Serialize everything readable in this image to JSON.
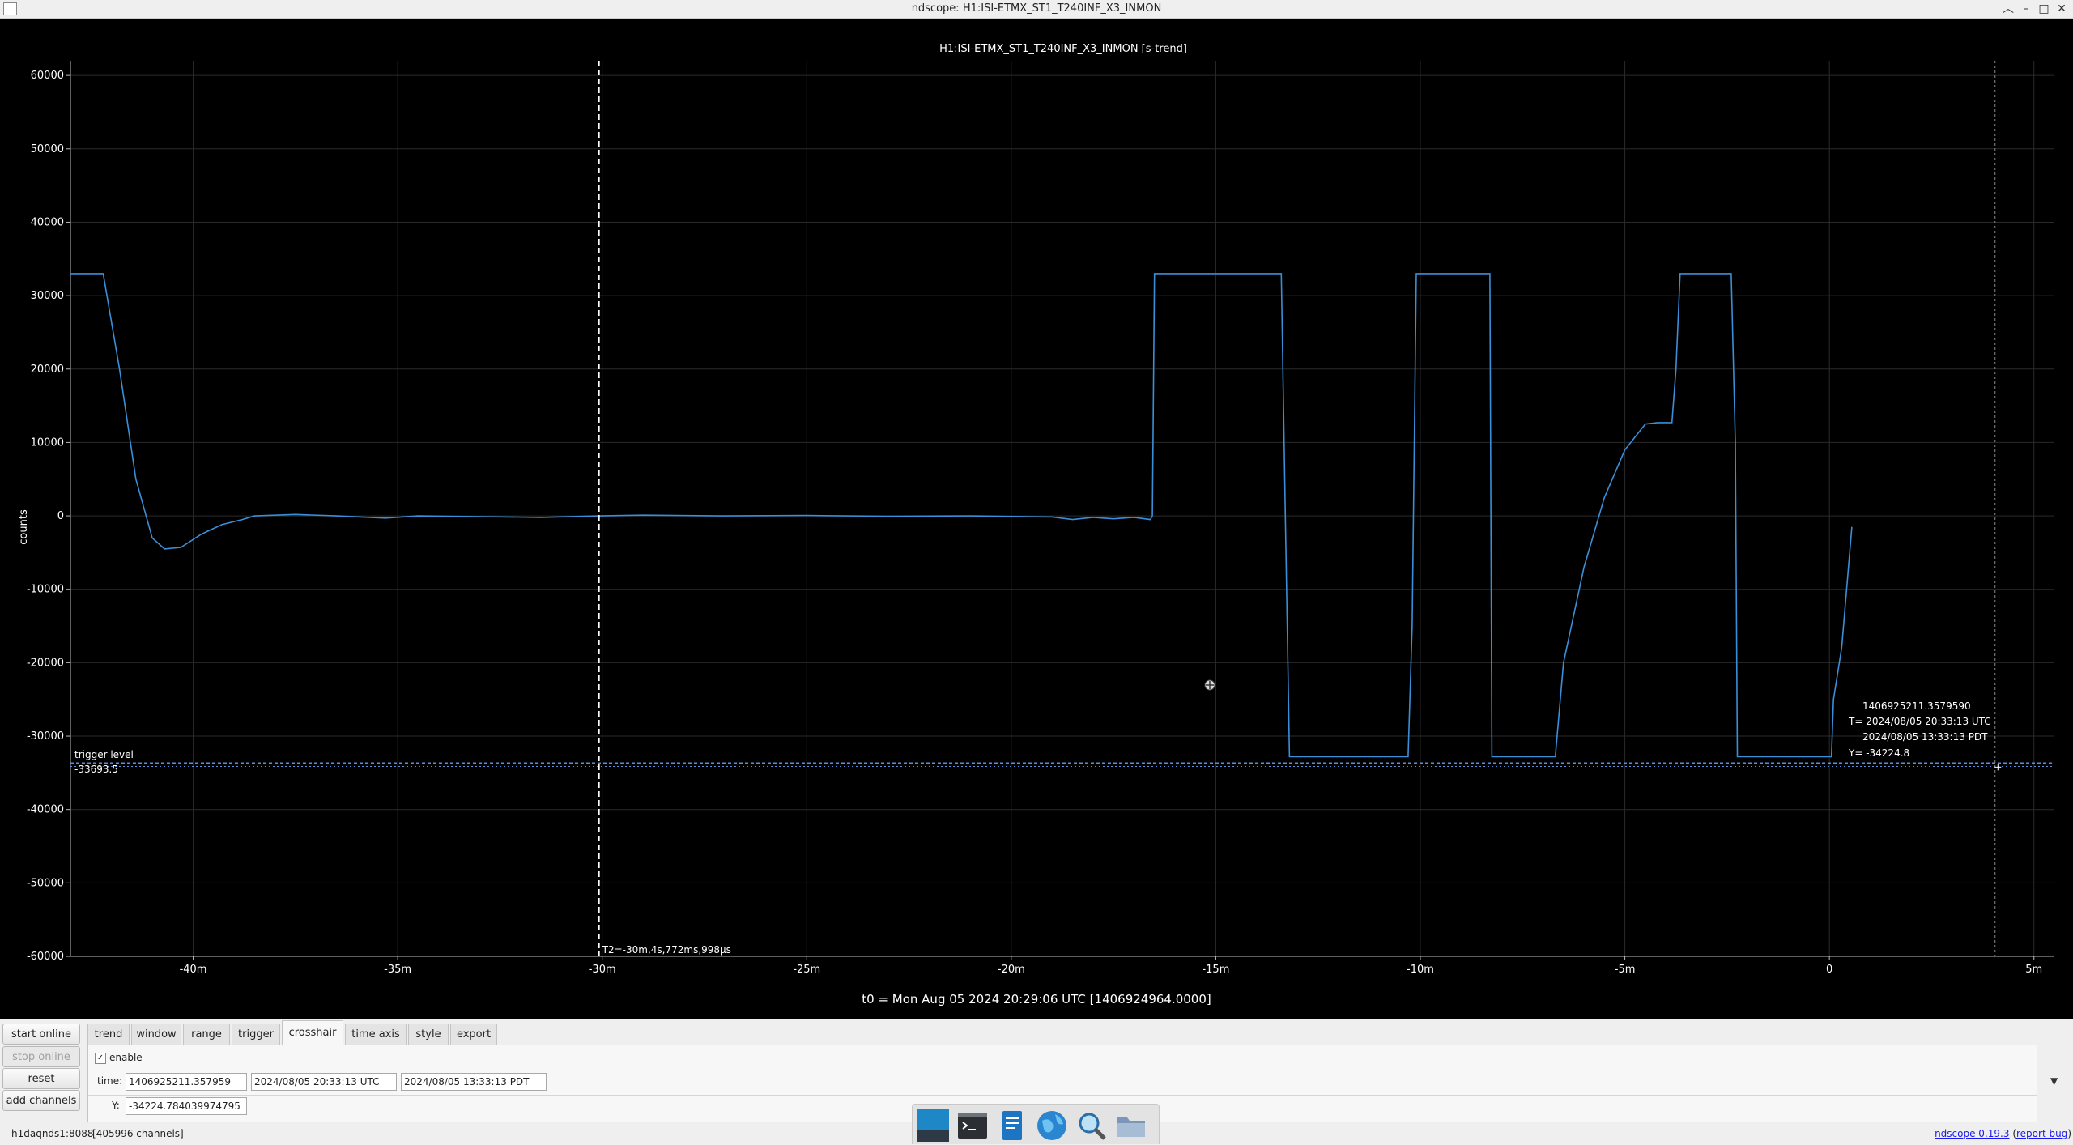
{
  "window": {
    "title": "ndscope: H1:ISI-ETMX_ST1_T240INF_X3_INMON"
  },
  "plot": {
    "title": "H1:ISI-ETMX_ST1_T240INF_X3_INMON [s-trend]",
    "ylabel": "counts",
    "t0_label": "t0 = Mon Aug 05 2024 20:29:06 UTC [1406924964.0000]",
    "trigger_label": "trigger level",
    "trigger_value_text": "-33693.5",
    "cursor_t2_label": "T2=-30m,4s,772ms,998μs",
    "crosshair_gps": "1406925211.3579590",
    "crosshair_utc": "T= 2024/08/05 20:33:13 UTC",
    "crosshair_pdt": "2024/08/05 13:33:13 PDT",
    "crosshair_y": "Y= -34224.8"
  },
  "chart_data": {
    "type": "line",
    "xlim": [
      -43,
      5.5
    ],
    "ylim": [
      -60000,
      62000
    ],
    "xticks": [
      -40,
      -35,
      -30,
      -25,
      -20,
      -15,
      -10,
      -5,
      0,
      5
    ],
    "xtick_labels": [
      "-40m",
      "-35m",
      "-30m",
      "-25m",
      "-20m",
      "-15m",
      "-10m",
      "-5m",
      "0",
      "5m"
    ],
    "yticks": [
      60000,
      50000,
      40000,
      30000,
      20000,
      10000,
      0,
      -10000,
      -20000,
      -30000,
      -40000,
      -50000,
      -60000
    ],
    "ytick_labels": [
      "60000",
      "50000",
      "40000",
      "30000",
      "20000",
      "10000",
      "0",
      "-10000",
      "-20000",
      "-30000",
      "-40000",
      "-50000",
      "-60000"
    ],
    "grid": true,
    "trigger_level": -33693.5,
    "cursor_t2": -30.08,
    "cursor_right": 4.05,
    "crosshair": {
      "x": 4.12,
      "y": -34224.8
    },
    "series": [
      {
        "color": "#3a8fd8",
        "x": [
          -43,
          -42.5,
          -42.2,
          -41.8,
          -41.4,
          -41.0,
          -40.7,
          -40.3,
          -39.8,
          -39.3,
          -38.8,
          -38.5,
          -37.5,
          -36.5,
          -35.3,
          -34.5,
          -33.0,
          -31.5,
          -30.08,
          -29.0,
          -27.0,
          -25.0,
          -23.0,
          -21.0,
          -19.0,
          -18.5,
          -18.0,
          -17.5,
          -17.0,
          -16.6,
          -16.55,
          -16.5,
          -13.4,
          -13.3,
          -13.2,
          -10.3,
          -10.2,
          -10.1,
          -9.95,
          -9.9,
          -8.3,
          -8.25,
          -7.8,
          -7.75,
          -6.7,
          -6.5,
          -6.0,
          -5.5,
          -5.0,
          -4.5,
          -4.2,
          -3.85,
          -3.75,
          -3.65,
          -3.3,
          -3.0,
          -2.4,
          -2.3,
          -2.25,
          -0.1,
          0.05,
          0.1,
          0.3,
          0.55
        ],
        "y": [
          33000,
          33000,
          33000,
          20000,
          5000,
          -3000,
          -4500,
          -4300,
          -2500,
          -1200,
          -500,
          0,
          200,
          0,
          -300,
          0,
          -100,
          -200,
          0,
          100,
          0,
          50,
          -50,
          0,
          -150,
          -500,
          -200,
          -400,
          -200,
          -500,
          0,
          33000,
          33000,
          0,
          -32800,
          -32800,
          -15000,
          33000,
          33000,
          33000,
          33000,
          -32800,
          -32800,
          -32800,
          -32800,
          -20000,
          -7000,
          2500,
          9000,
          12500,
          12700,
          12700,
          20000,
          33000,
          33000,
          33000,
          33000,
          10000,
          -32800,
          -32800,
          -32800,
          -25000,
          -18000,
          -1500
        ]
      }
    ]
  },
  "tabs": [
    "trend",
    "window",
    "range",
    "trigger",
    "crosshair",
    "time axis",
    "style",
    "export"
  ],
  "active_tab": "crosshair",
  "side_buttons": {
    "start_online": "start online",
    "stop_online": "stop online",
    "reset": "reset",
    "add_channels": "add channels"
  },
  "crosshair_panel": {
    "enable_label": "enable",
    "enable_check": "✓",
    "time_label": "time:",
    "time_gps": "1406925211.357959",
    "time_utc": "2024/08/05 20:33:13 UTC",
    "time_pdt": "2024/08/05 13:33:13 PDT",
    "y_label": "Y:",
    "y_value": "-34224.784039974795",
    "expand_arrow": "▼"
  },
  "status": {
    "server": "h1daqnds1:8088",
    "channels": "[405996 channels]",
    "version_link": "ndscope 0.19.3",
    "report_link": "report bug",
    "paren_open": "(",
    "paren_close": ")"
  },
  "taskbar": {
    "icons": [
      "workspace-icon",
      "terminal-icon",
      "text-editor-icon",
      "web-browser-icon",
      "search-icon",
      "file-manager-icon"
    ]
  }
}
